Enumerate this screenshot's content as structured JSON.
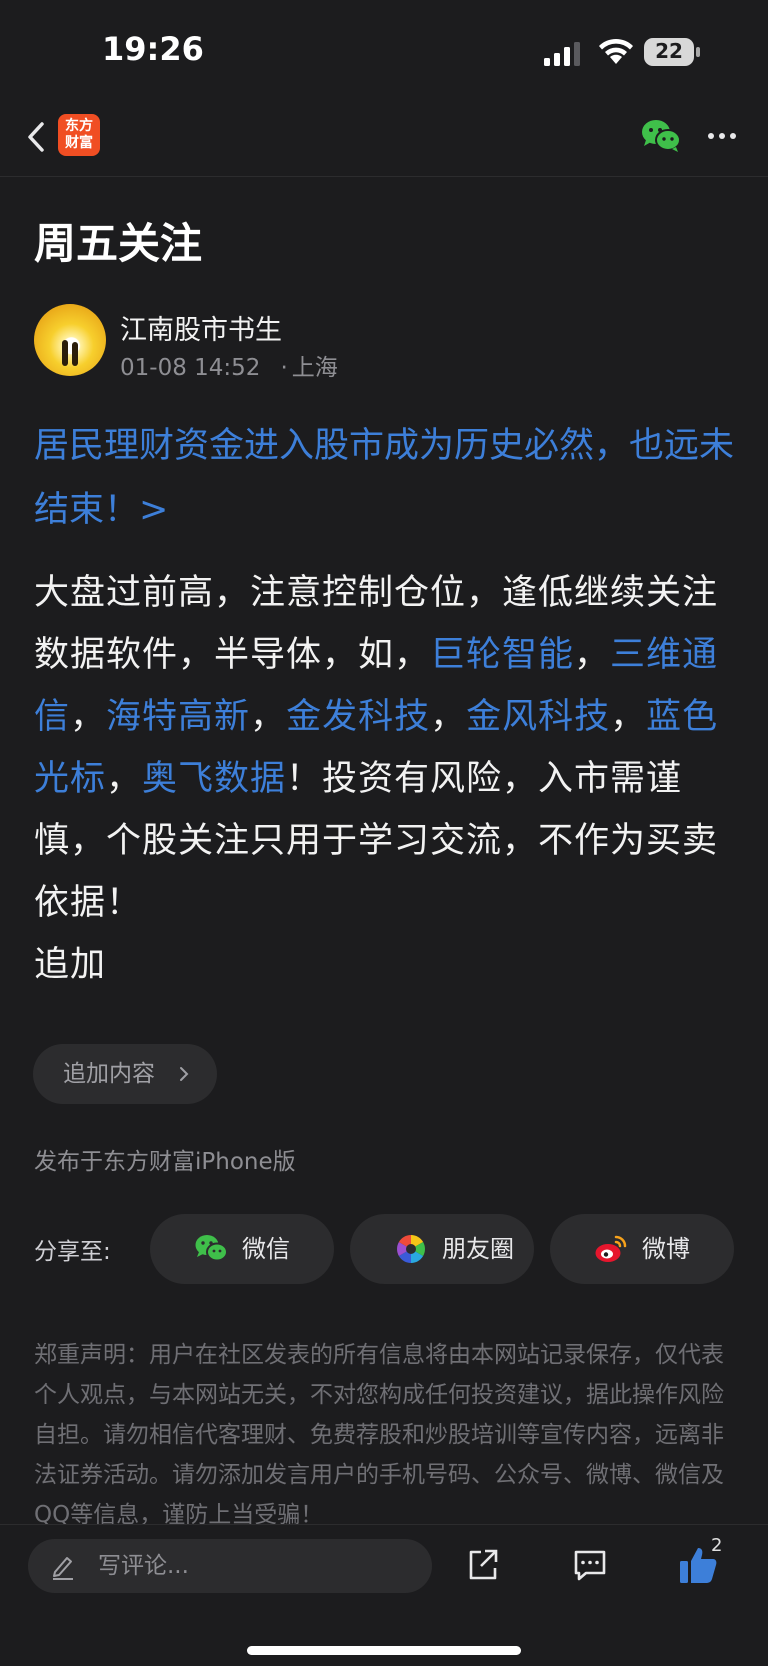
{
  "status_bar": {
    "time": "19:26",
    "battery": "22"
  },
  "nav": {
    "logo_line1": "东方",
    "logo_line2": "财富"
  },
  "post": {
    "title": "周五关注",
    "author": "江南股市书生",
    "datetime": "01-08 14:52",
    "location_sep": "·",
    "location": "上海",
    "linked_article": "居民理财资金进入股市成为历史必然，也远未结束！>",
    "body": {
      "intro": "大盘过前高，注意控制仓位，逢低继续关注数据软件，半导体，如，",
      "stock_1": "巨轮智能",
      "sep_1": "，",
      "stock_2": "三维通信",
      "sep_2": "，",
      "stock_3": "海特高新",
      "sep_3": "，",
      "stock_4": "金发科技",
      "sep_4": "，",
      "stock_5": "金风科技",
      "sep_5": "，",
      "stock_6": "蓝色光标",
      "sep_6": "，",
      "stock_7": "奥飞数据",
      "outro": "！投资有风险，入市需谨慎，个股关注只用于学习交流，不作为买卖依据！",
      "addendum": "追加"
    },
    "append_button": "追加内容",
    "source": "发布于东方财富iPhone版"
  },
  "share": {
    "label": "分享至:",
    "wechat": "微信",
    "moments": "朋友圈",
    "weibo": "微博"
  },
  "disclaimer": "郑重声明：用户在社区发表的所有信息将由本网站记录保存，仅代表个人观点，与本网站无关，不对您构成任何投资建议，据此操作风险自担。请勿相信代客理财、免费荐股和炒股培训等宣传内容，远离非法证券活动。请勿添加发言用户的手机号码、公众号、微博、微信及QQ等信息，谨防上当受骗！",
  "bottom_bar": {
    "comment_placeholder": "写评论...",
    "like_count": "2"
  },
  "colors": {
    "link": "#3d7fd9",
    "background": "#1c1c1e",
    "brand": "#f04e23",
    "wechat": "#3fbf4a"
  },
  "icons": [
    "back-arrow-icon",
    "wechat-icon",
    "more-icon",
    "chevron-right-icon",
    "wechat-icon",
    "moments-icon",
    "weibo-icon",
    "pen-icon",
    "share-out-icon",
    "comment-icon",
    "thumbs-up-icon"
  ]
}
